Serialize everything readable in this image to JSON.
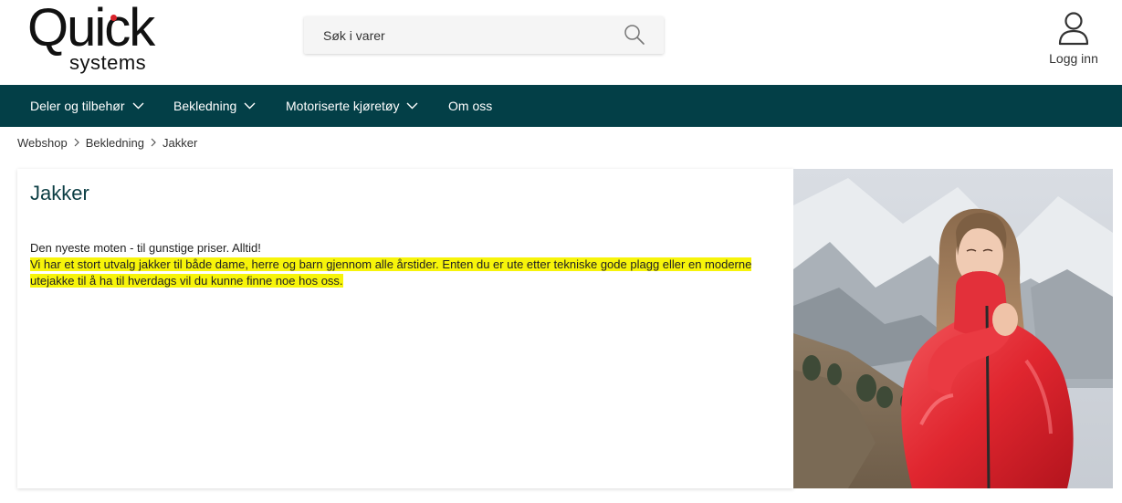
{
  "brand": {
    "name_top": "Quick",
    "name_bottom": "systems",
    "dot_color": "#d8232a"
  },
  "search": {
    "placeholder": "Søk i varer",
    "icon": "search-icon"
  },
  "account": {
    "login_label": "Logg inn",
    "icon": "user-icon"
  },
  "nav": {
    "background": "#033f47",
    "items": [
      {
        "label": "Deler og tilbehør",
        "has_dropdown": true
      },
      {
        "label": "Bekledning",
        "has_dropdown": true
      },
      {
        "label": "Motoriserte kjøretøy",
        "has_dropdown": true
      },
      {
        "label": "Om oss",
        "has_dropdown": false
      }
    ]
  },
  "breadcrumb": [
    "Webshop",
    "Bekledning",
    "Jakker"
  ],
  "category": {
    "title": "Jakker",
    "intro": "Den nyeste moten - til gunstige priser. Alltid!",
    "description": "Vi har et stort utvalg jakker til både dame, herre og barn gjennom alle årstider. Enten du er ute etter tekniske gode plagg eller en moderne utejakke til å ha til hverdags vil du kunne finne noe hos oss.",
    "highlight_color": "#f7f40a"
  }
}
